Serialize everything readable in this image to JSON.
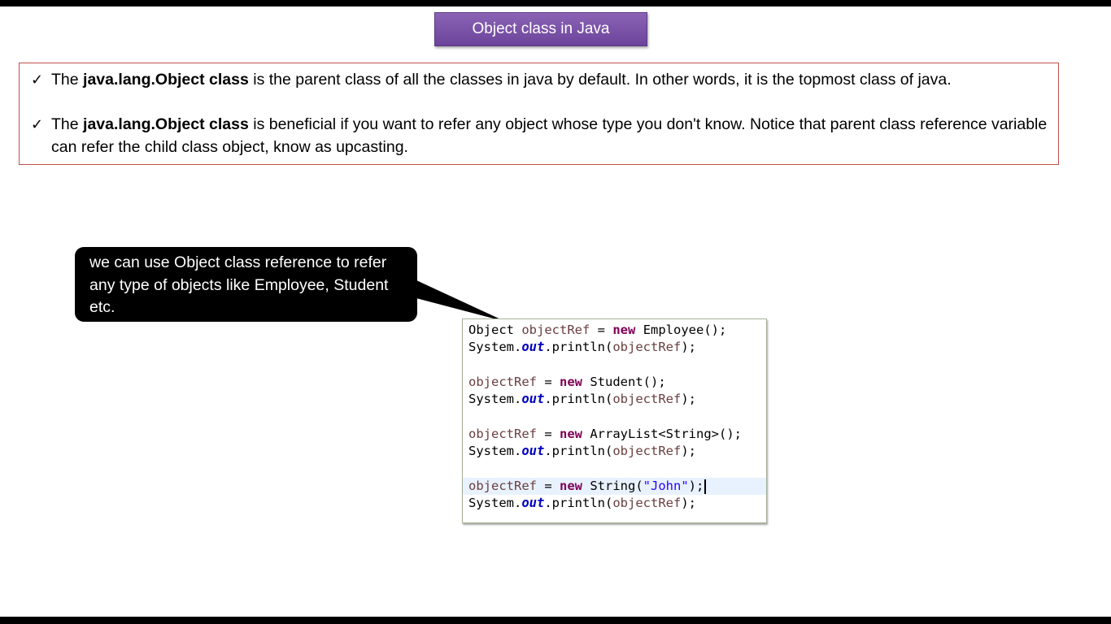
{
  "slide": {
    "title": "Object class in Java",
    "notes": [
      {
        "prefix": "The  ",
        "bold": "java.lang.Object class",
        "rest": " is the parent class of all the classes in java by default. In other words, it is the topmost class of java."
      },
      {
        "prefix": "The ",
        "bold": "java.lang.Object class",
        "rest": " is beneficial if you want to refer any object whose type you don't know. Notice that parent class reference variable can refer the child class object, know as upcasting."
      }
    ],
    "callout": "we can use Object class reference to refer any type of objects like Employee, Student etc."
  },
  "code": {
    "obj_type": "Object",
    "var": "objectRef",
    "kw_new": "new",
    "system": "System.",
    "out": "out",
    "println_open": ".println(",
    "close": ");",
    "assign": " = ",
    "call_close": "();",
    "employee": "Employee",
    "student": "Student",
    "arraylist": "ArrayList<String>",
    "string_open": "String(",
    "string_literal": "\"John\""
  },
  "colors": {
    "title_bg": "#7a55a8",
    "notes_border": "#c0504d",
    "keyword": "#7f0055",
    "local_var": "#6a3e3e",
    "static_field": "#0000c0",
    "string_literal": "#2a00ff",
    "current_line_highlight": "#e8f2fe"
  }
}
